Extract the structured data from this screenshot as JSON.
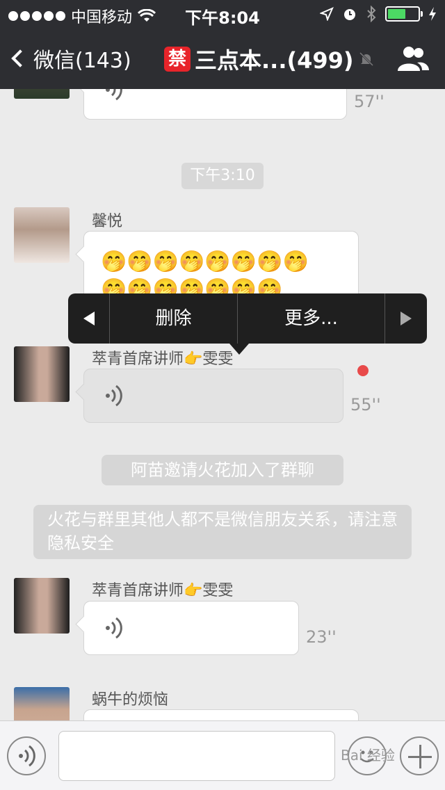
{
  "status_bar": {
    "carrier": "中国移动",
    "time": "下午8:04"
  },
  "nav": {
    "back_label": "微信(143)",
    "forbid_badge": "禁",
    "title": "三点本...(499)"
  },
  "chat": {
    "top_duration": "57''",
    "time_divider": "下午3:10",
    "msg1": {
      "sender": "馨悦",
      "emoji_row1": "🤭🤭🤭🤭🤭🤭🤭🤭",
      "emoji_row2": "🤭🤭🤭🤭🤭🤭🤭"
    },
    "msg2": {
      "sender": "萃青首席讲师👉雯雯",
      "duration": "55''"
    },
    "system1": "阿苗邀请火花加入了群聊",
    "system2": "火花与群里其他人都不是微信朋友关系，请注意隐私安全",
    "msg3": {
      "sender": "萃青首席讲师👉雯雯",
      "duration": "23''"
    },
    "msg4": {
      "sender": "蜗牛的烦恼"
    }
  },
  "popup_menu": {
    "delete_label": "删除",
    "more_label": "更多..."
  },
  "watermark": "Bai 经验"
}
